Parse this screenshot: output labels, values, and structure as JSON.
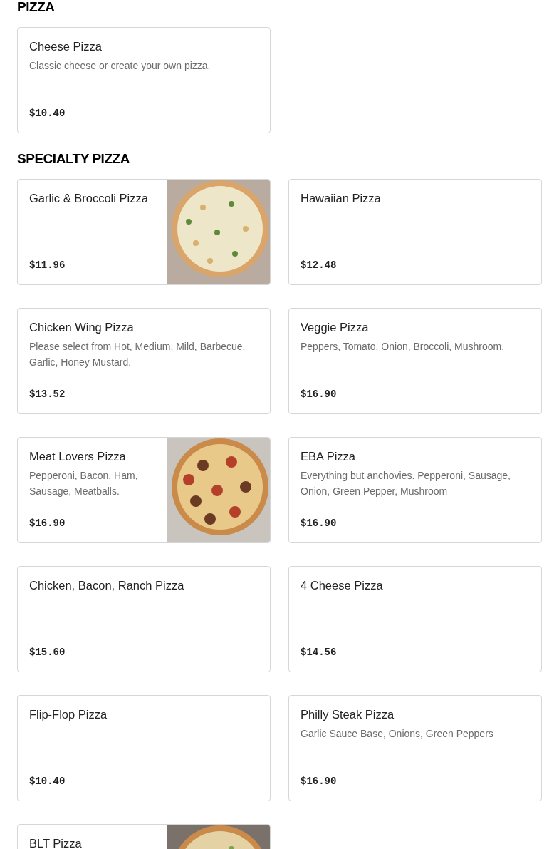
{
  "sections": [
    {
      "title": "PIZZA",
      "items": [
        {
          "name": "Cheese Pizza",
          "description": "Classic cheese or create your own pizza.",
          "price": "$10.40"
        }
      ]
    },
    {
      "title": "SPECIALTY PIZZA",
      "items": [
        {
          "name": "Garlic & Broccoli Pizza",
          "price": "$11.96",
          "photo": true
        },
        {
          "name": "Hawaiian Pizza",
          "price": "$12.48"
        },
        {
          "name": "Chicken Wing Pizza",
          "description": "Please select from Hot, Medium, Mild, Barbecue, Garlic, Honey Mustard.",
          "price": "$13.52"
        },
        {
          "name": "Veggie Pizza",
          "description": "Peppers, Tomato, Onion, Broccoli, Mushroom.",
          "price": "$16.90"
        },
        {
          "name": "Meat Lovers Pizza",
          "description": "Pepperoni, Bacon, Ham, Sausage, Meatballs.",
          "price": "$16.90",
          "photo": true
        },
        {
          "name": "EBA Pizza",
          "description": "Everything but anchovies. Pepperoni, Sausage, Onion, Green Pepper, Mushroom",
          "price": "$16.90"
        },
        {
          "name": "Chicken, Bacon, Ranch Pizza",
          "price": "$15.60"
        },
        {
          "name": "4 Cheese Pizza",
          "price": "$14.56"
        },
        {
          "name": "Flip-Flop Pizza",
          "price": "$10.40"
        },
        {
          "name": "Philly Steak Pizza",
          "description": "Garlic Sauce Base, Onions, Green Peppers",
          "price": "$16.90"
        },
        {
          "name": "BLT Pizza",
          "photo": true
        }
      ]
    }
  ]
}
